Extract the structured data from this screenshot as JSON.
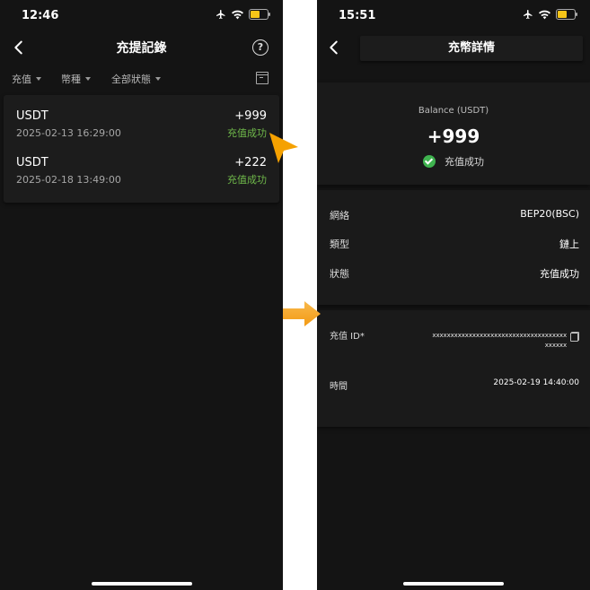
{
  "left": {
    "status_time": "12:46",
    "title": "充提記錄",
    "help_icon": "?",
    "filters": [
      "充值",
      "幣種",
      "全部狀態"
    ],
    "records": [
      {
        "coin": "USDT",
        "time": "2025-02-13 16:29:00",
        "amount": "+999",
        "status": "充值成功"
      },
      {
        "coin": "USDT",
        "time": "2025-02-18 13:49:00",
        "amount": "+222",
        "status": "充值成功"
      }
    ]
  },
  "right": {
    "status_time": "15:51",
    "title": "充幣詳情",
    "balance_label": "Balance (USDT)",
    "balance_value": "+999",
    "balance_status": "充值成功",
    "details": [
      {
        "label": "網絡",
        "value": "BEP20(BSC)"
      },
      {
        "label": "類型",
        "value": "鏈上"
      },
      {
        "label": "狀態",
        "value": "充值成功"
      }
    ],
    "deposit_id_label": "充值 ID*",
    "deposit_id_value": "xxxxxxxxxxxxxxxxxxxxxxxxxxxxxxxxxxxxxxxxxxx",
    "time_label": "時間",
    "time_value": "2025-02-19 14:40:00"
  },
  "colors": {
    "accent_cursor": "#f5a100",
    "arrow": "#f6a623",
    "success": "#6fb84a",
    "check": "#3fb34f",
    "background": "#141414"
  }
}
